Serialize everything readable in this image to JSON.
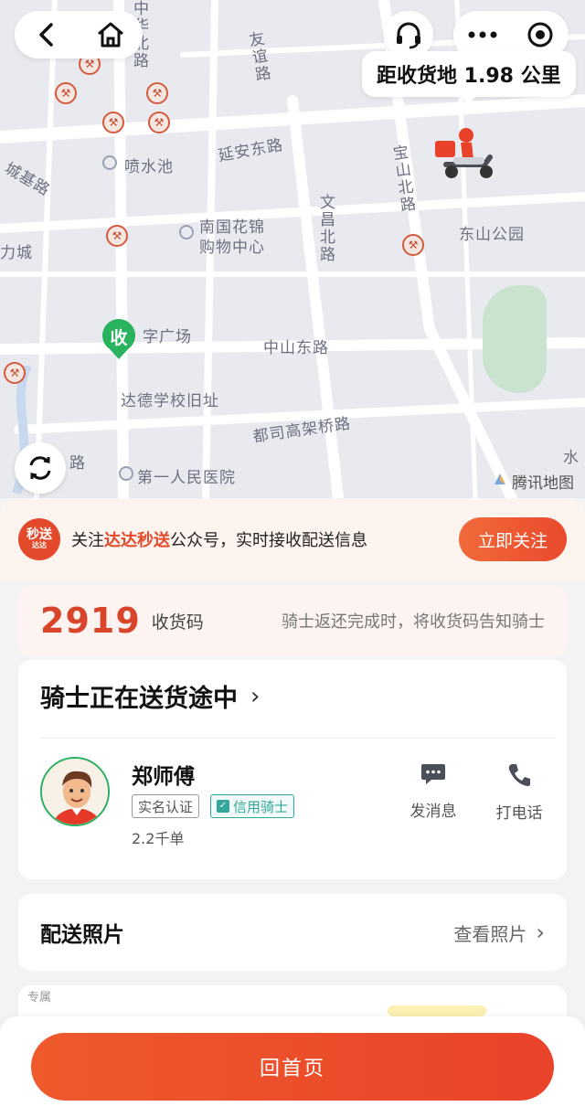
{
  "map": {
    "distance_text": "距收货地 1.98 公里",
    "brand": "腾讯地图",
    "receive_marker": "收",
    "labels": {
      "road_zhonghua_north": "中华北路",
      "road_youyi": "友谊路",
      "pool_penshui": "喷水池",
      "road_chengji": "城基路",
      "road_yanan_east": "延安东路",
      "road_baoshan_north": "宝山北路",
      "mall_nanguo_1": "南国花锦",
      "mall_nanguo_2": "购物中心",
      "road_wenchang_north": "文昌北路",
      "park_dongshan": "东山公园",
      "city_left": "力城",
      "square": "字广场",
      "road_zhongshan_east": "中山东路",
      "school_old": "达德学校旧址",
      "bridge_dusi": "都司高架桥路",
      "road_left_bottom": "路",
      "hospital": "第一人民医院",
      "edge_right": "水"
    }
  },
  "follow": {
    "logo_line1": "秒送",
    "logo_line2": "达达",
    "text_prefix": "关注",
    "text_highlight": "达达秒送",
    "text_suffix": "公众号，实时接收配送信息",
    "button": "立即关注"
  },
  "code": {
    "number": "2919",
    "label": "收货码",
    "hint": "骑士返还完成时，将收货码告知骑士"
  },
  "rider": {
    "status": "骑士正在送货途中",
    "name": "郑师傅",
    "badge_auth": "实名认证",
    "badge_credit": "信用骑士",
    "orders": "2.2千单",
    "message_label": "发消息",
    "call_label": "打电话"
  },
  "photo": {
    "title": "配送照片",
    "link": "查看照片"
  },
  "exclusive": {
    "label": "专属"
  },
  "bottom": {
    "home_button": "回首页"
  }
}
